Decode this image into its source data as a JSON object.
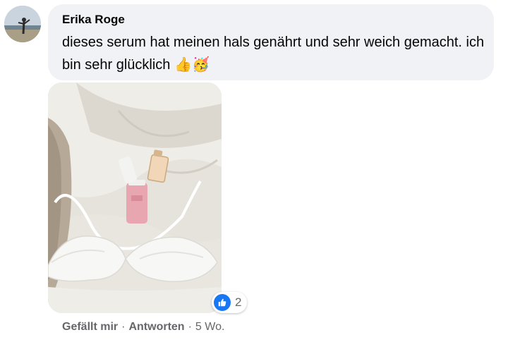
{
  "comment": {
    "author": "Erika Roge",
    "text": "dieses serum hat meinen hals genährt und sehr weich gemacht. ich bin sehr glücklich",
    "emojis": "👍🥳",
    "reaction_count": "2",
    "actions": {
      "like_label": "Gefällt mir",
      "reply_label": "Antworten",
      "separator": "·",
      "timestamp": "5 Wo."
    }
  },
  "icons": {
    "reaction": "thumbs-up-icon"
  },
  "colors": {
    "bubble_bg": "#f0f2f5",
    "like_blue": "#1877f2",
    "meta_gray": "#65676b"
  }
}
